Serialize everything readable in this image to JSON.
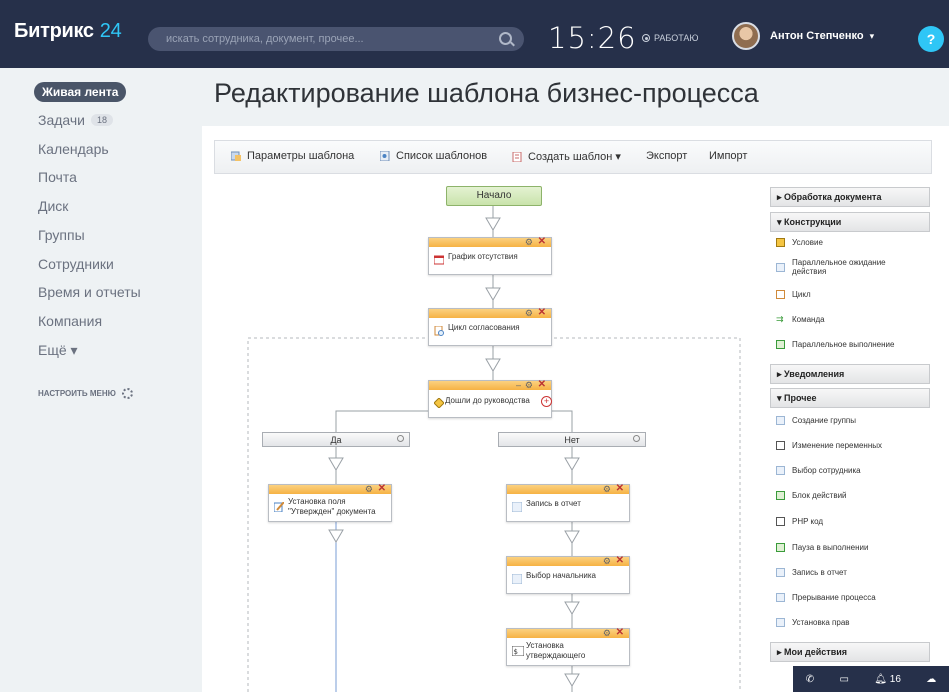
{
  "header": {
    "logo_main": "Битрикс",
    "logo_num": "24",
    "search_placeholder": "искать сотрудника, документ, прочее...",
    "clock": "15:26",
    "work_status": "РАБОТАЮ",
    "user_name": "Антон Степченко",
    "user_caret": "▾",
    "help": "?"
  },
  "sidebar": {
    "items": [
      {
        "label": "Живая лента"
      },
      {
        "label": "Задачи",
        "badge": "18"
      },
      {
        "label": "Календарь"
      },
      {
        "label": "Почта"
      },
      {
        "label": "Диск"
      },
      {
        "label": "Группы"
      },
      {
        "label": "Сотрудники"
      },
      {
        "label": "Время и отчеты"
      },
      {
        "label": "Компания"
      },
      {
        "label": "Ещё ▾"
      }
    ],
    "configure": "НАСТРОИТЬ МЕНЮ"
  },
  "page_title": "Редактирование шаблона бизнес-процесса",
  "toolbar": {
    "params": "Параметры шаблона",
    "list": "Список шаблонов",
    "create": "Создать шаблон ▾",
    "export": "Экспорт",
    "import": "Импорт"
  },
  "flow": {
    "start": "Начало",
    "a1": "График отсутствия",
    "a2": "Цикл согласования",
    "cond": "Дошли до руководства",
    "branch_yes": "Да",
    "branch_no": "Нет",
    "left1_l1": "Установка поля",
    "left1_l2": "\"Утвержден\" документа",
    "right1": "Запись в отчет",
    "right2": "Выбор начальника",
    "right3_l1": "Установка",
    "right3_l2": "утверждающего"
  },
  "palette": {
    "g1": "▸ Обработка документа",
    "g2": "▾ Конструкции",
    "c1": "Условие",
    "c2_l1": "Параллельное ожидание",
    "c2_l2": "действия",
    "c3": "Цикл",
    "c4": "Команда",
    "c5": "Параллельное выполнение",
    "g3": "▸ Уведомления",
    "g4": "▾ Прочее",
    "p1": "Создание группы",
    "p2": "Изменение переменных",
    "p3": "Выбор сотрудника",
    "p4": "Блок действий",
    "p5": "PHP код",
    "p6": "Пауза в выполнении",
    "p7": "Запись в отчет",
    "p8": "Прерывание процесса",
    "p9": "Установка прав",
    "g5": "▸ Мои действия"
  },
  "bottombar": {
    "count": "16"
  },
  "colors": {
    "header_bg": "#26304a",
    "accent": "#2fc6f6",
    "activity_bar": "#f6b244",
    "start_block": "#c9e3ab"
  }
}
